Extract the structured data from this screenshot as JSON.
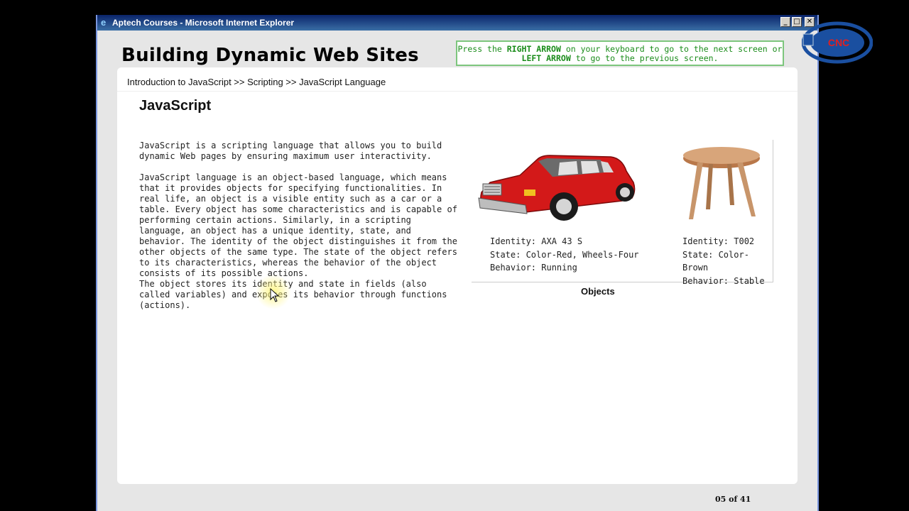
{
  "window": {
    "title": "Aptech Courses - Microsoft Internet Explorer",
    "min_glyph": "_",
    "max_glyph": "□",
    "close_glyph": "✕"
  },
  "course": {
    "title": "Building Dynamic Web Sites"
  },
  "nav_hint": {
    "part1": "Press the ",
    "right_arrow": "RIGHT ARROW",
    "part2": " on your keyboard to go to the next screen or",
    "left_arrow": "LEFT ARROW",
    "part3": " to go to the previous screen."
  },
  "breadcrumb": "Introduction to JavaScript >> Scripting >> JavaScript Language",
  "page": {
    "heading": "JavaScript",
    "paragraphs": [
      "JavaScript is a scripting language that allows you to build dynamic Web pages by ensuring maximum user interactivity.",
      "JavaScript language is an object-based language, which means that it provides objects for specifying functionalities. In real life, an object is a visible entity such as a car or a table. Every object has some characteristics and is capable of performing certain actions. Similarly, in a scripting language, an object has a unique identity, state, and behavior. The identity of the object distinguishes it from the other objects of the same type. The state of the object refers to its characteristics, whereas the behavior of the object consists of its possible actions.",
      "The object stores its identity and state in fields (also called variables) and exposes its behavior through functions (actions)."
    ]
  },
  "objects": {
    "caption": "Objects",
    "car": {
      "identity": "Identity: AXA 43 S",
      "state": "State: Color-Red, Wheels-Four",
      "behavior": "Behavior: Running"
    },
    "table": {
      "identity": "Identity: T002",
      "state": "State: Color-Brown",
      "behavior": "Behavior: Stable"
    }
  },
  "page_counter": "05 of 41",
  "logo": {
    "text": "CNC"
  },
  "colors": {
    "titlebar": "#0a246a",
    "hint_green": "#1a8c1a",
    "car_red": "#d31919",
    "table_brown": "#c8956a",
    "logo_blue": "#1a4fa0"
  }
}
